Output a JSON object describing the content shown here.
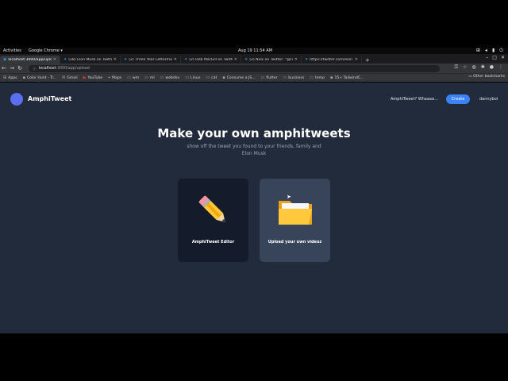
{
  "system_bar": {
    "activities": "Activities",
    "app": "Google Chrome ▾",
    "clock": "Aug 19 11:54 AM"
  },
  "tabs": [
    {
      "title": "localhost:3000/app/upload",
      "active": true
    },
    {
      "title": "(28) Elon Musk on Twitter"
    },
    {
      "title": "(2) Three Year Letterman"
    },
    {
      "title": "(2) Deb MarGill on Twitter"
    },
    {
      "title": "(2) Nick on Twitter: \"@rich"
    },
    {
      "title": "https://twitter.com/elon"
    }
  ],
  "address": {
    "host": "localhost",
    "path": ":3000/app/upload"
  },
  "bookmarks": [
    "Apps",
    "Color Hunt - Tr...",
    "Gmail",
    "YouTube",
    "Maps",
    "wm",
    "ml",
    "webdev",
    "Linux",
    "cat",
    "Consume a JS...",
    "flutter",
    "business",
    "temp",
    "15+ TailwindC..."
  ],
  "bookmarks_other": "Other bookmarks",
  "header": {
    "brand": "AmphiTweet",
    "link": "AmphiTweet? Whaaaa...",
    "create": "Create",
    "user": "dannyboi"
  },
  "hero": {
    "title": "Make your own amphitweets",
    "subtitle": "show off the tweet you found to your friends, family and Elon Musk"
  },
  "cards": {
    "editor": "AmphiTweet Editor",
    "upload": "Upload your own videoz"
  },
  "colors": {
    "page_bg": "#222b3b",
    "accent": "#3b82f6",
    "logo": "#5a6ff0"
  },
  "icons": {
    "editor": "pencil-icon",
    "upload": "folder-icon"
  }
}
